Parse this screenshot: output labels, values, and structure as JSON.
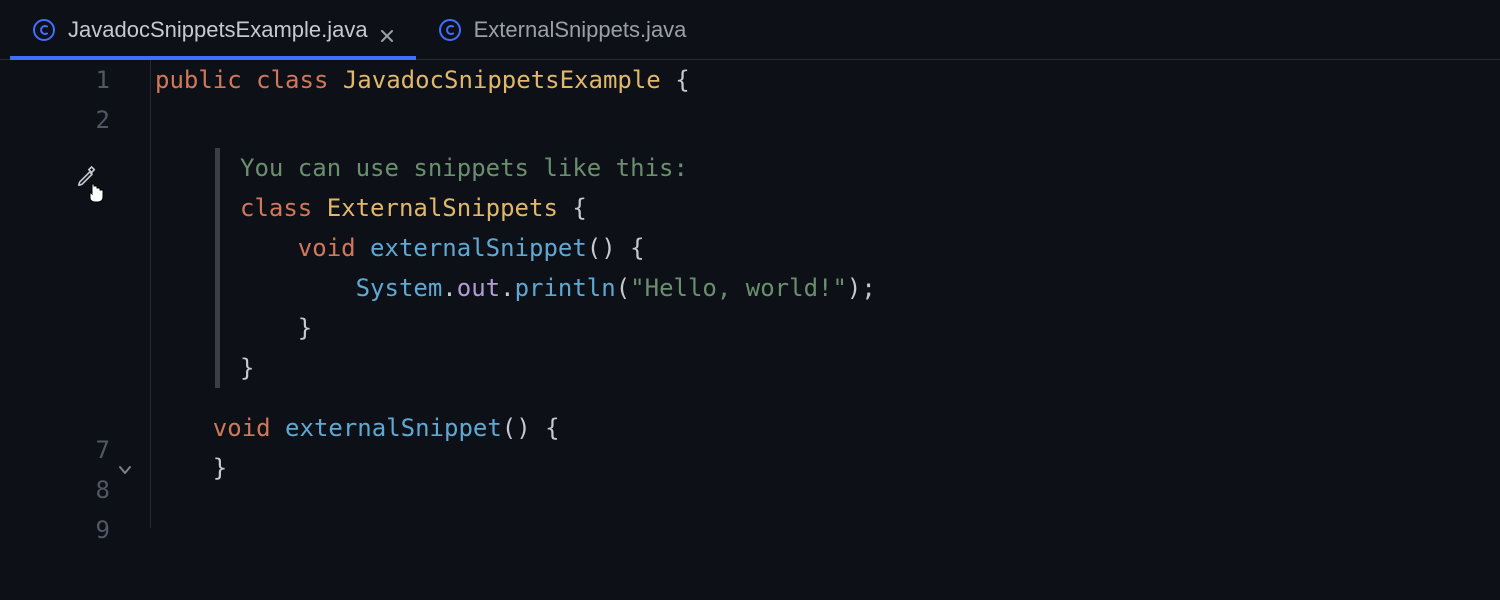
{
  "tabs": [
    {
      "label": "JavadocSnippetsExample.java",
      "active": true,
      "closeable": true
    },
    {
      "label": "ExternalSnippets.java",
      "active": false,
      "closeable": false
    }
  ],
  "gutter": {
    "line_numbers": [
      "1",
      "2",
      "",
      "",
      "",
      "",
      "7",
      "8",
      "9"
    ]
  },
  "code": {
    "line1": {
      "kw_public": "public",
      "kw_class": "class",
      "cls": "JavadocSnippetsExample",
      "brace": "{"
    },
    "doc": {
      "intro": "You can use snippets like this:",
      "l1_kw": "class",
      "l1_cls": "ExternalSnippets",
      "l1_b": " {",
      "l2_kw": "void",
      "l2_fn": "externalSnippet",
      "l2_p": "()",
      "l2_b": " {",
      "l3_sys": "System",
      "l3_d1": ".",
      "l3_out": "out",
      "l3_d2": ".",
      "l3_pl": "println",
      "l3_lp": "(",
      "l3_str": "\"Hello, world!\"",
      "l3_rp": ");",
      "l4": "    }",
      "l5": "}"
    },
    "line7": {
      "kw_void": "void",
      "fn": "externalSnippet",
      "p": "()",
      "b": " {"
    },
    "line8": "    }"
  }
}
